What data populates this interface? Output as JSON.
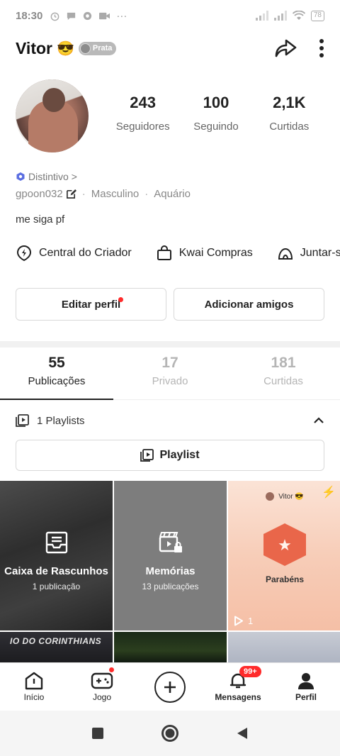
{
  "status_bar": {
    "time": "18:30",
    "battery": "78"
  },
  "profile": {
    "name": "Vitor",
    "emoji": "😎",
    "rank_label": "Prata",
    "stats": [
      {
        "value": "243",
        "label": "Seguidores"
      },
      {
        "value": "100",
        "label": "Seguindo"
      },
      {
        "value": "2,1K",
        "label": "Curtidas"
      }
    ],
    "badge_link": "Distintivo",
    "badge_chevron": ">",
    "username": "gpoon032",
    "gender": "Masculino",
    "sign": "Aquário",
    "separator": "·",
    "bio": "me siga pf"
  },
  "shortcuts": [
    {
      "label": "Central do Criador",
      "icon": "lightning-pin-icon"
    },
    {
      "label": "Kwai Compras",
      "icon": "shopping-bag-icon"
    },
    {
      "label": "Juntar-s",
      "icon": "tent-icon"
    }
  ],
  "buttons": {
    "edit_profile": "Editar perfil",
    "add_friends": "Adicionar amigos"
  },
  "tabs": [
    {
      "count": "55",
      "label": "Publicações",
      "active": true
    },
    {
      "count": "17",
      "label": "Privado",
      "active": false
    },
    {
      "count": "181",
      "label": "Curtidas",
      "active": false
    }
  ],
  "playlist": {
    "row_label": "1 Playlists",
    "button_label": "Playlist"
  },
  "grid": {
    "drafts": {
      "title": "Caixa de Rascunhos",
      "sub": "1 publicação"
    },
    "memories": {
      "title": "Memórias",
      "sub": "13 publicações"
    },
    "video": {
      "header_name": "Vitor 😎",
      "title": "Parabéns",
      "play_count": "1"
    },
    "row2_text": "IO DO CORINTHIANS"
  },
  "bottom_nav": {
    "inicio": "Início",
    "jogo": "Jogo",
    "mensagens": "Mensagens",
    "mensagens_badge": "99+",
    "perfil": "Perfil"
  },
  "colors": {
    "accent_red": "#ff2b2b",
    "badge_blue": "#5b6ee1"
  }
}
